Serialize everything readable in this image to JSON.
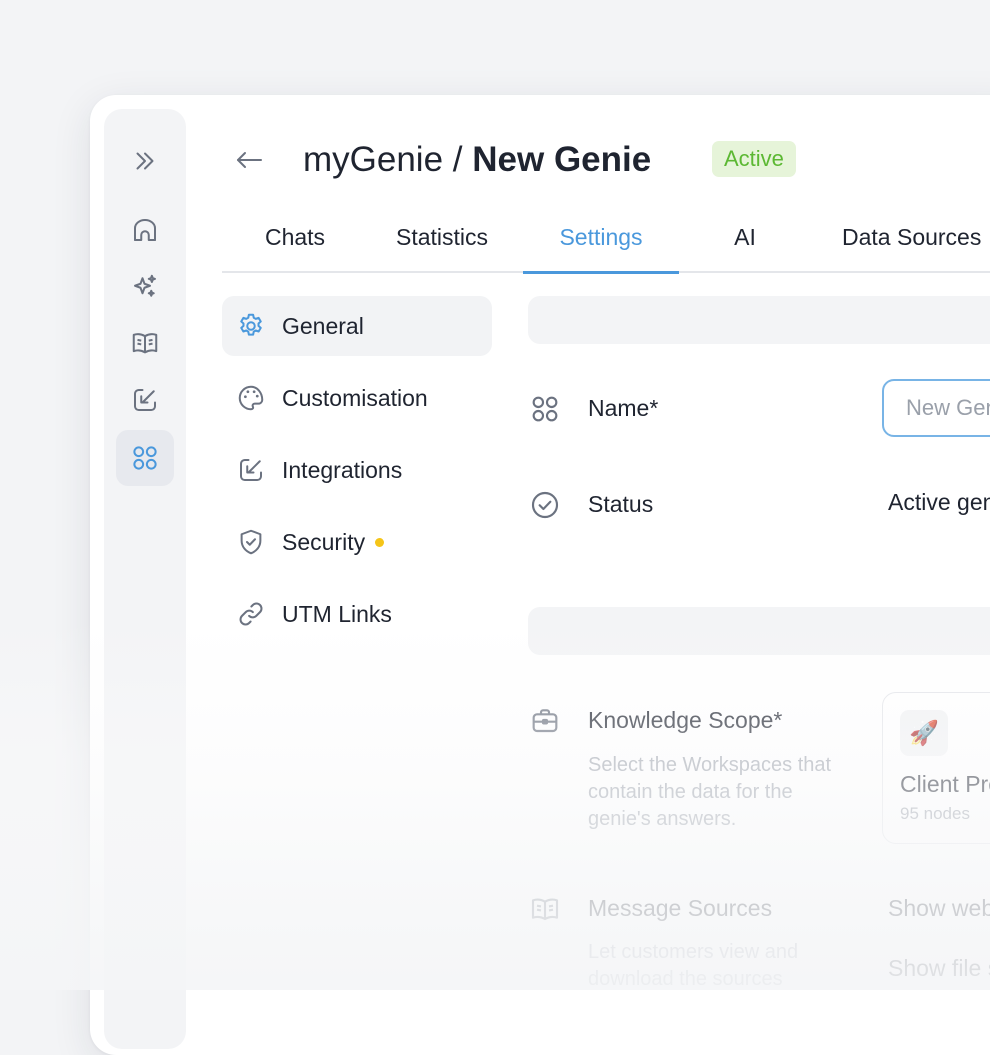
{
  "header": {
    "breadcrumb_parent": "myGenie",
    "breadcrumb_separator": "/",
    "breadcrumb_current": "New Genie",
    "status_badge": "Active",
    "back_icon": "arrow-left-icon"
  },
  "rail": {
    "items": [
      {
        "icon": "chevrons-right-icon"
      },
      {
        "icon": "home-icon"
      },
      {
        "icon": "sparkles-icon"
      },
      {
        "icon": "book-icon"
      },
      {
        "icon": "integration-arrow-icon"
      },
      {
        "icon": "command-icon",
        "active": true
      }
    ]
  },
  "tabs": [
    {
      "label": "Chats"
    },
    {
      "label": "Statistics"
    },
    {
      "label": "Settings",
      "active": true
    },
    {
      "label": "AI"
    },
    {
      "label": "Data Sources"
    }
  ],
  "subnav": [
    {
      "label": "General",
      "icon": "gear-icon",
      "active": true
    },
    {
      "label": "Customisation",
      "icon": "palette-icon"
    },
    {
      "label": "Integrations",
      "icon": "integration-arrow-icon"
    },
    {
      "label": "Security",
      "icon": "shield-check-icon",
      "has_dot": true
    },
    {
      "label": "UTM Links",
      "icon": "link-icon"
    }
  ],
  "general": {
    "name_label": "Name*",
    "name_placeholder": "New Genie",
    "status_label": "Status",
    "status_value": "Active genie",
    "knowledge_label": "Knowledge Scope*",
    "knowledge_desc": "Select the Workspaces that contain the data for the genie's answers.",
    "workspace_card": {
      "emoji": "🚀",
      "name": "Client Projects",
      "nodes": "95 nodes"
    },
    "message_sources_label": "Message Sources",
    "message_sources_desc": "Let customers view and download the sources",
    "message_sources_opt1": "Show web sources",
    "message_sources_opt2": "Show file sources"
  },
  "colors": {
    "accent": "#4a98dc",
    "badge_bg": "#e6f4d9",
    "badge_text": "#5cb833",
    "security_dot": "#f5c518"
  }
}
